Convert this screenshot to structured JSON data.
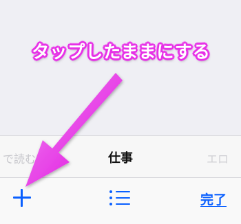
{
  "annotation": {
    "text": "タップしたままにする",
    "color": "#e733e7"
  },
  "picker": {
    "items": [
      {
        "label": "で読む"
      },
      {
        "label": "仕事"
      },
      {
        "label": "エロ"
      }
    ],
    "selected": "仕事"
  },
  "toolbar": {
    "add_icon": "plus-icon",
    "list_icon": "list-icon",
    "done_label": "完了",
    "accent_color": "#0a60ff"
  }
}
